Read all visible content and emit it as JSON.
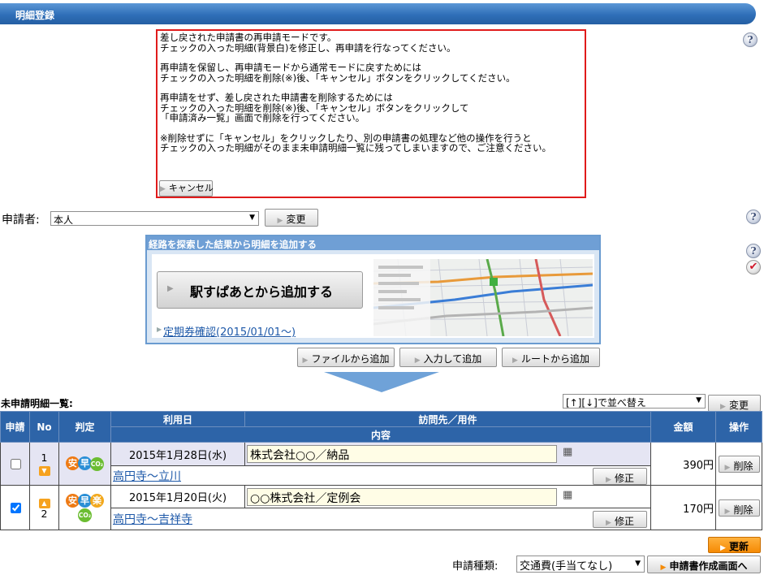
{
  "header": {
    "title": "明細登録"
  },
  "notice": {
    "paragraphs": [
      "差し戻された申請書の再申請モードです。\nチェックの入った明細(背景白)を修正し、再申請を行なってください。",
      "再申請を保留し、再申請モードから通常モードに戻すためには\nチェックの入った明細を削除(※)後、「キャンセル」ボタンをクリックしてください。",
      "再申請をせず、差し戻された申請書を削除するためには\nチェックの入った明細を削除(※)後、「キャンセル」ボタンをクリックして\n「申請済み一覧」画面で削除を行ってください。",
      "※削除せずに「キャンセル」をクリックしたり、別の申請書の処理など他の操作を行うと\nチェックの入った明細がそのまま未申請明細一覧に残ってしまいますので、ご注意ください。"
    ],
    "cancel_label": "キャンセル"
  },
  "applicant": {
    "label": "申請者:",
    "value": "本人",
    "change_label": "変更"
  },
  "route_panel": {
    "title": "経路を探索した結果から明細を追加する",
    "ekispert_label": "駅すぱあとから追加する",
    "pass_link": "定期券確認(2015/01/01〜)"
  },
  "add_buttons": {
    "file": "ファイルから追加",
    "input": "入力して追加",
    "route": "ルートから追加"
  },
  "list": {
    "title": "未申請明細一覧:",
    "sort_value": "[↑][↓]で並べ替え",
    "sort_change_label": "変更",
    "headers": {
      "apply": "申請",
      "no": "No",
      "judge": "判定",
      "date": "利用日",
      "visit": "訪問先／用件",
      "content": "内容",
      "amount": "金額",
      "action": "操作"
    },
    "rows": [
      {
        "checked": false,
        "no": "1",
        "date": "2015年1月28日(水)",
        "visit": "株式会社○○／納品",
        "route": "高円寺〜立川",
        "amount": "390円",
        "edit_label": "修正",
        "delete_label": "削除"
      },
      {
        "checked": true,
        "no": "2",
        "date": "2015年1月20日(火)",
        "visit": "○○株式会社／定例会",
        "route": "高円寺〜吉祥寺",
        "amount": "170円",
        "edit_label": "修正",
        "delete_label": "削除"
      }
    ],
    "badges": {
      "an": "安",
      "haya": "早",
      "raku": "楽",
      "co2": "CO₂"
    }
  },
  "footer": {
    "update_label": "更新",
    "type_label": "申請種類:",
    "type_value": "交通費(手当てなし)",
    "create_label": "申請書作成画面へ"
  },
  "colors": {
    "header": "#2f6fb8",
    "table_header": "#2d64a8",
    "notice_border": "#e01b1b",
    "accent_orange": "#f58a04"
  },
  "icons": [
    "help-icon",
    "check-icon",
    "calendar-icon",
    "orange-arrow-icon",
    "triangle-icon"
  ]
}
